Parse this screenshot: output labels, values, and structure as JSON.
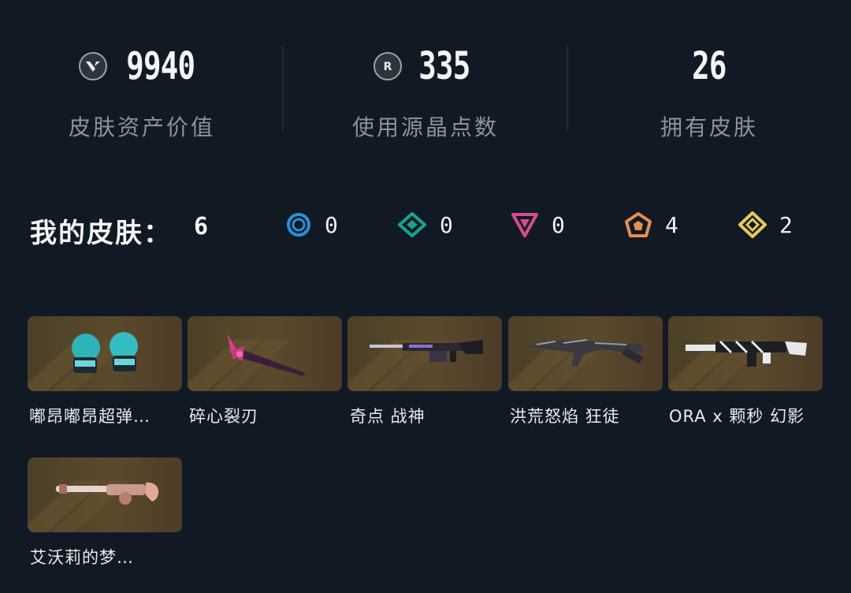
{
  "stats": [
    {
      "value": "9940",
      "label": "皮肤资产价值",
      "icon": "valorant-points-icon"
    },
    {
      "value": "335",
      "label": "使用源晶点数",
      "icon": "radianite-points-icon"
    },
    {
      "value": "26",
      "label": "拥有皮肤",
      "icon": ""
    }
  ],
  "summary": {
    "title": "我的皮肤：",
    "total": "6",
    "tiers": [
      {
        "name": "select-tier",
        "color": "#2b8fd6",
        "count": "0"
      },
      {
        "name": "deluxe-tier",
        "color": "#1aa38a",
        "count": "0"
      },
      {
        "name": "premium-tier",
        "color": "#d44c8c",
        "count": "0"
      },
      {
        "name": "exclusive-tier",
        "color": "#e58e52",
        "count": "4"
      },
      {
        "name": "ultra-tier",
        "color": "#e6c85a",
        "count": "2"
      }
    ]
  },
  "skins": [
    {
      "name": "嘟昂嘟昂超弹…"
    },
    {
      "name": "碎心裂刃"
    },
    {
      "name": "奇点 战神"
    },
    {
      "name": "洪荒怒焰 狂徒"
    },
    {
      "name": "ORA x 颗秒 幻影"
    },
    {
      "name": "艾沃莉的梦…"
    }
  ]
}
